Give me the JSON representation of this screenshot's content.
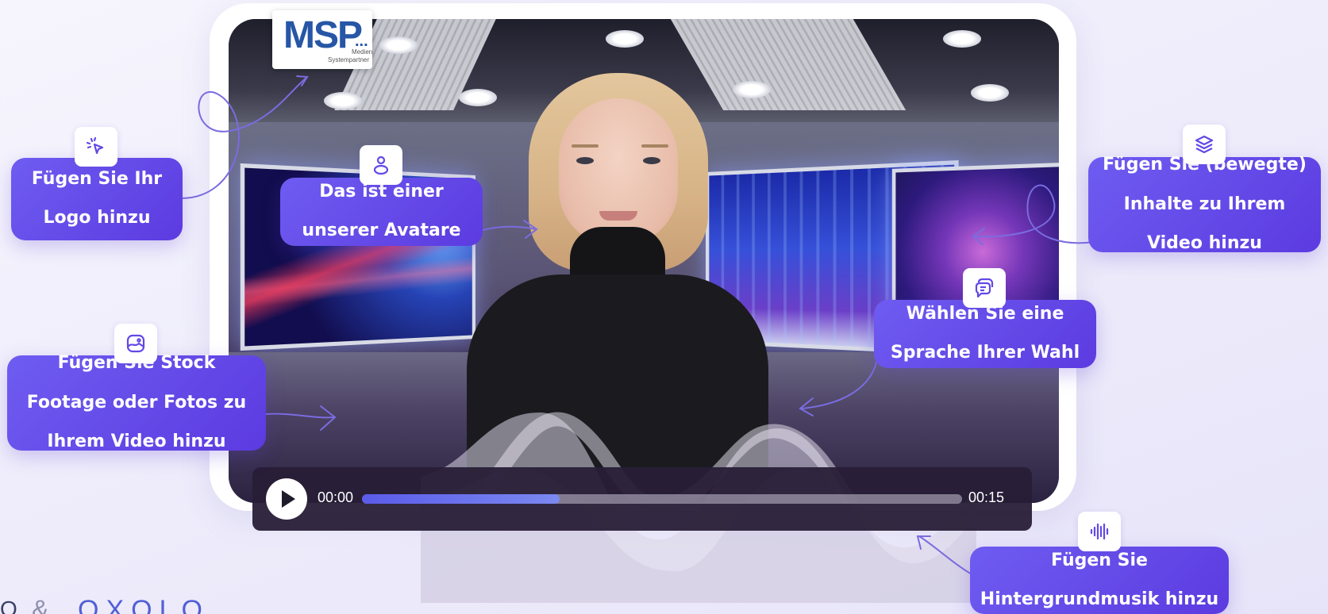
{
  "callouts": {
    "logo": {
      "line1": "Fügen Sie Ihr",
      "line2": "Logo hinzu",
      "icon": "cursor-sparkle-icon"
    },
    "avatar": {
      "line1": "Das ist einer",
      "line2": "unserer  Avatare",
      "icon": "person-icon"
    },
    "stock": {
      "line1": "Fügen Sie Stock",
      "line2": "Footage oder Fotos zu",
      "line3": "Ihrem Video hinzu",
      "icon": "image-icon"
    },
    "content": {
      "line1": "Fügen Sie (bewegte)",
      "line2": "Inhalte zu Ihrem",
      "line3": "Video hinzu",
      "icon": "layers-icon"
    },
    "language": {
      "line1": "Wählen Sie eine",
      "line2": "Sprache Ihrer Wahl",
      "icon": "chat-bubbles-icon"
    },
    "music": {
      "line1": "Fügen Sie",
      "line2": "Hintergrundmusik hinzu",
      "icon": "soundwave-icon"
    }
  },
  "logo": {
    "main": "MSP",
    "dots": "...",
    "sub1": "Medien",
    "sub2": "Systempartner"
  },
  "player": {
    "current_time": "00:00",
    "end_time": "00:15",
    "progress": 0.33
  },
  "brand": {
    "fragment": "Q",
    "amp": "&",
    "word": "OXOLO"
  },
  "colors": {
    "accent": "#6249e6",
    "accent_light": "#7a6cf2",
    "player_bg": "#281e37",
    "progress": "#5b5bea"
  }
}
